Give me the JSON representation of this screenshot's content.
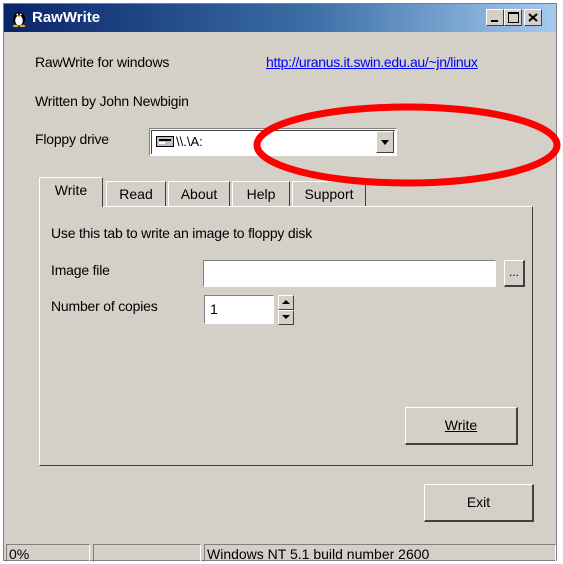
{
  "window": {
    "title": "RawWrite"
  },
  "header": {
    "app_name": "RawWrite for windows",
    "url": "http://uranus.it.swin.edu.au/~jn/linux",
    "author": "Written by John Newbigin"
  },
  "floppy": {
    "label": "Floppy drive",
    "selected": "\\\\.\\A:"
  },
  "tabs": [
    {
      "label": "Write"
    },
    {
      "label": "Read"
    },
    {
      "label": "About"
    },
    {
      "label": "Help"
    },
    {
      "label": "Support"
    }
  ],
  "write_tab": {
    "instructions": "Use this tab to write an image to floppy disk",
    "image_file_label": "Image file",
    "image_file_value": "",
    "browse_label": "...",
    "copies_label": "Number of copies",
    "copies_value": "1",
    "write_button": "Write"
  },
  "exit_button": "Exit",
  "status_bar": {
    "progress": "0%",
    "middle": "",
    "system": "Windows NT 5.1 build number 2600"
  },
  "annotation": {
    "color": "#ff0000"
  }
}
